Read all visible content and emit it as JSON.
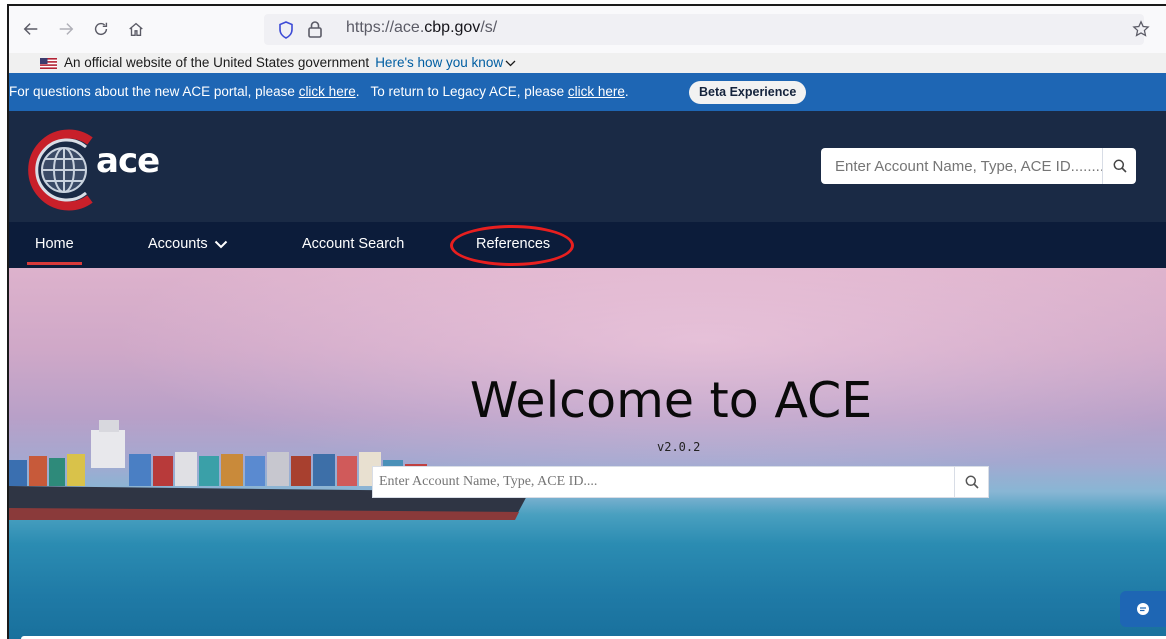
{
  "browser": {
    "url_prefix": "https://ace.",
    "url_domain": "cbp.gov",
    "url_suffix": "/s/"
  },
  "gov_banner": {
    "text": "An official website of the United States government",
    "link": "Here's how you know"
  },
  "notice": {
    "prefix": "For questions about the new ACE portal, please ",
    "link1": "click here",
    "middle": ".   To return to Legacy ACE, please ",
    "link2": "click here",
    "end": ".",
    "beta_label": "Beta Experience"
  },
  "header": {
    "logo_text": "ace",
    "search_placeholder": "Enter Account Name, Type, ACE ID........"
  },
  "nav": {
    "items": [
      {
        "label": "Home",
        "active": true
      },
      {
        "label": "Accounts",
        "has_dropdown": true
      },
      {
        "label": "Account Search"
      },
      {
        "label": "References",
        "highlighted": true
      }
    ]
  },
  "hero": {
    "title": "Welcome to ACE",
    "version": "v2.0.2",
    "search_placeholder": "Enter Account Name, Type, ACE ID...."
  },
  "colors": {
    "header_bg": "#1a2a45",
    "nav_bg": "#0c1c3a",
    "notice_bg": "#1e66b4",
    "highlight_circle": "#e81f1f",
    "active_underline": "#d83a3a"
  }
}
